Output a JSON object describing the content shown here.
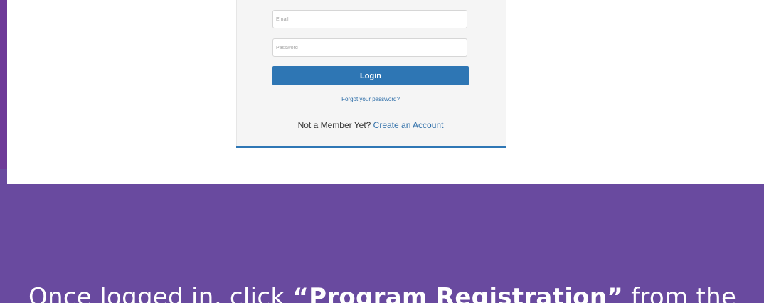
{
  "login": {
    "email_placeholder": "Email",
    "password_placeholder": "Password",
    "login_label": "Login",
    "forgot_password": "Forgot your password?",
    "not_member_text": "Not a Member Yet?",
    "create_account": "Create an Account"
  },
  "caption": {
    "before": "Once logged in, click ",
    "emphasis": "“Program Registration”",
    "after": " from the"
  },
  "colors": {
    "background_purple": "#694a9f",
    "button_blue": "#2e76b4",
    "link_blue": "#2e6ea8",
    "panel_gray": "#f5f5f5"
  }
}
